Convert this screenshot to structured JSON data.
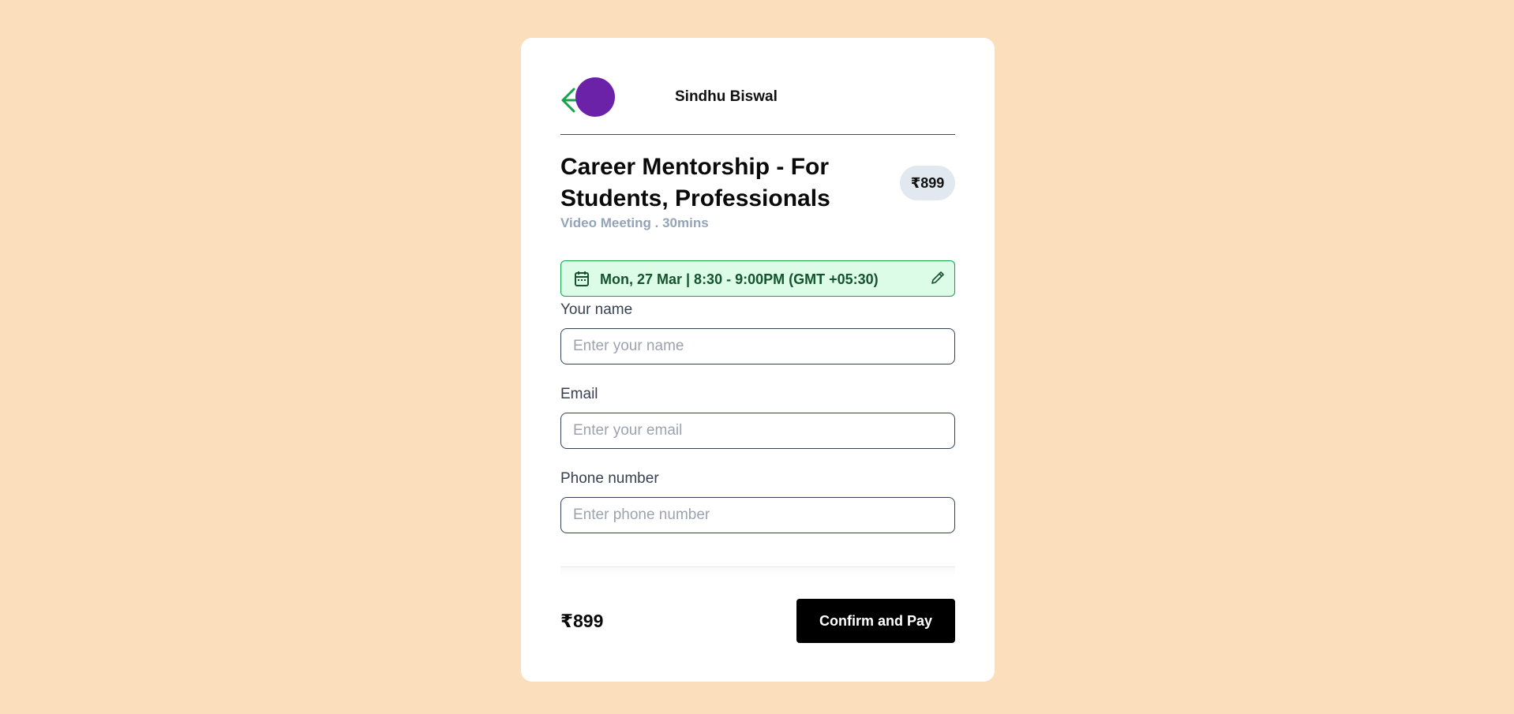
{
  "host": {
    "name": "Sindhu Biswal",
    "avatar_color": "#6b21a8"
  },
  "icons": {
    "back": "arrow-left-icon",
    "calendar": "calendar-icon",
    "edit": "pencil-icon"
  },
  "service": {
    "title": "Career Mentorship - For Students, Professionals",
    "price": "₹899",
    "subtitle": "Video Meeting . 30mins"
  },
  "slot": {
    "text": "Mon, 27 Mar | 8:30 - 9:00PM (GMT +05:30)"
  },
  "form": {
    "name": {
      "label": "Your name",
      "placeholder": "Enter your name",
      "value": ""
    },
    "email": {
      "label": "Email",
      "placeholder": "Enter your email",
      "value": ""
    },
    "phone": {
      "label": "Phone number",
      "placeholder": "Enter phone number",
      "value": ""
    }
  },
  "footer": {
    "price": "₹899",
    "button_label": "Confirm and Pay"
  },
  "colors": {
    "page_background": "#fbdfbd",
    "accent_green": "#16a34a",
    "slot_background": "#dcfce7",
    "button_background": "#000000"
  }
}
